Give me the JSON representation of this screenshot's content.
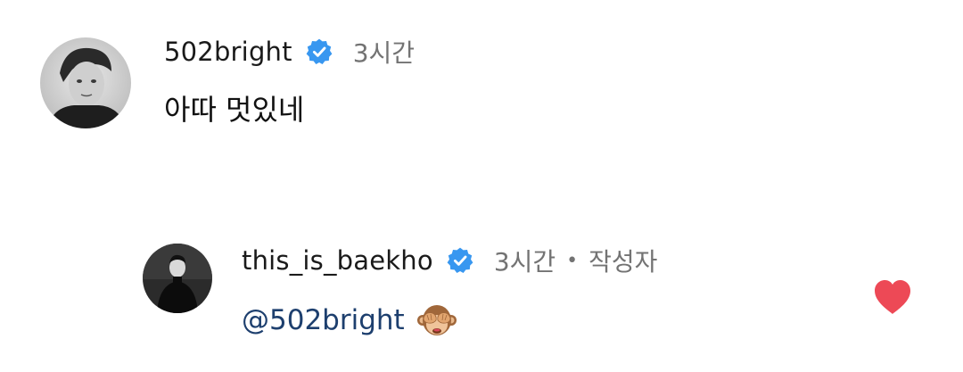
{
  "comments": [
    {
      "username": "502bright",
      "verified": true,
      "time": "3시간",
      "text": "아따 멋있네",
      "avatar_icon": "avatar-photo-bw"
    }
  ],
  "replies": [
    {
      "username": "this_is_baekho",
      "verified": true,
      "time": "3시간",
      "separator": "•",
      "author_label": "작성자",
      "mention": "@502bright",
      "emoji": "see-no-evil-monkey-emoji",
      "liked": true,
      "like_icon": "heart-icon",
      "avatar_icon": "avatar-photo-dark"
    }
  ],
  "colors": {
    "verified_blue": "#3897f0",
    "mention_blue": "#1d3f6e",
    "like_red": "#ed4956",
    "meta_gray": "#737373"
  }
}
